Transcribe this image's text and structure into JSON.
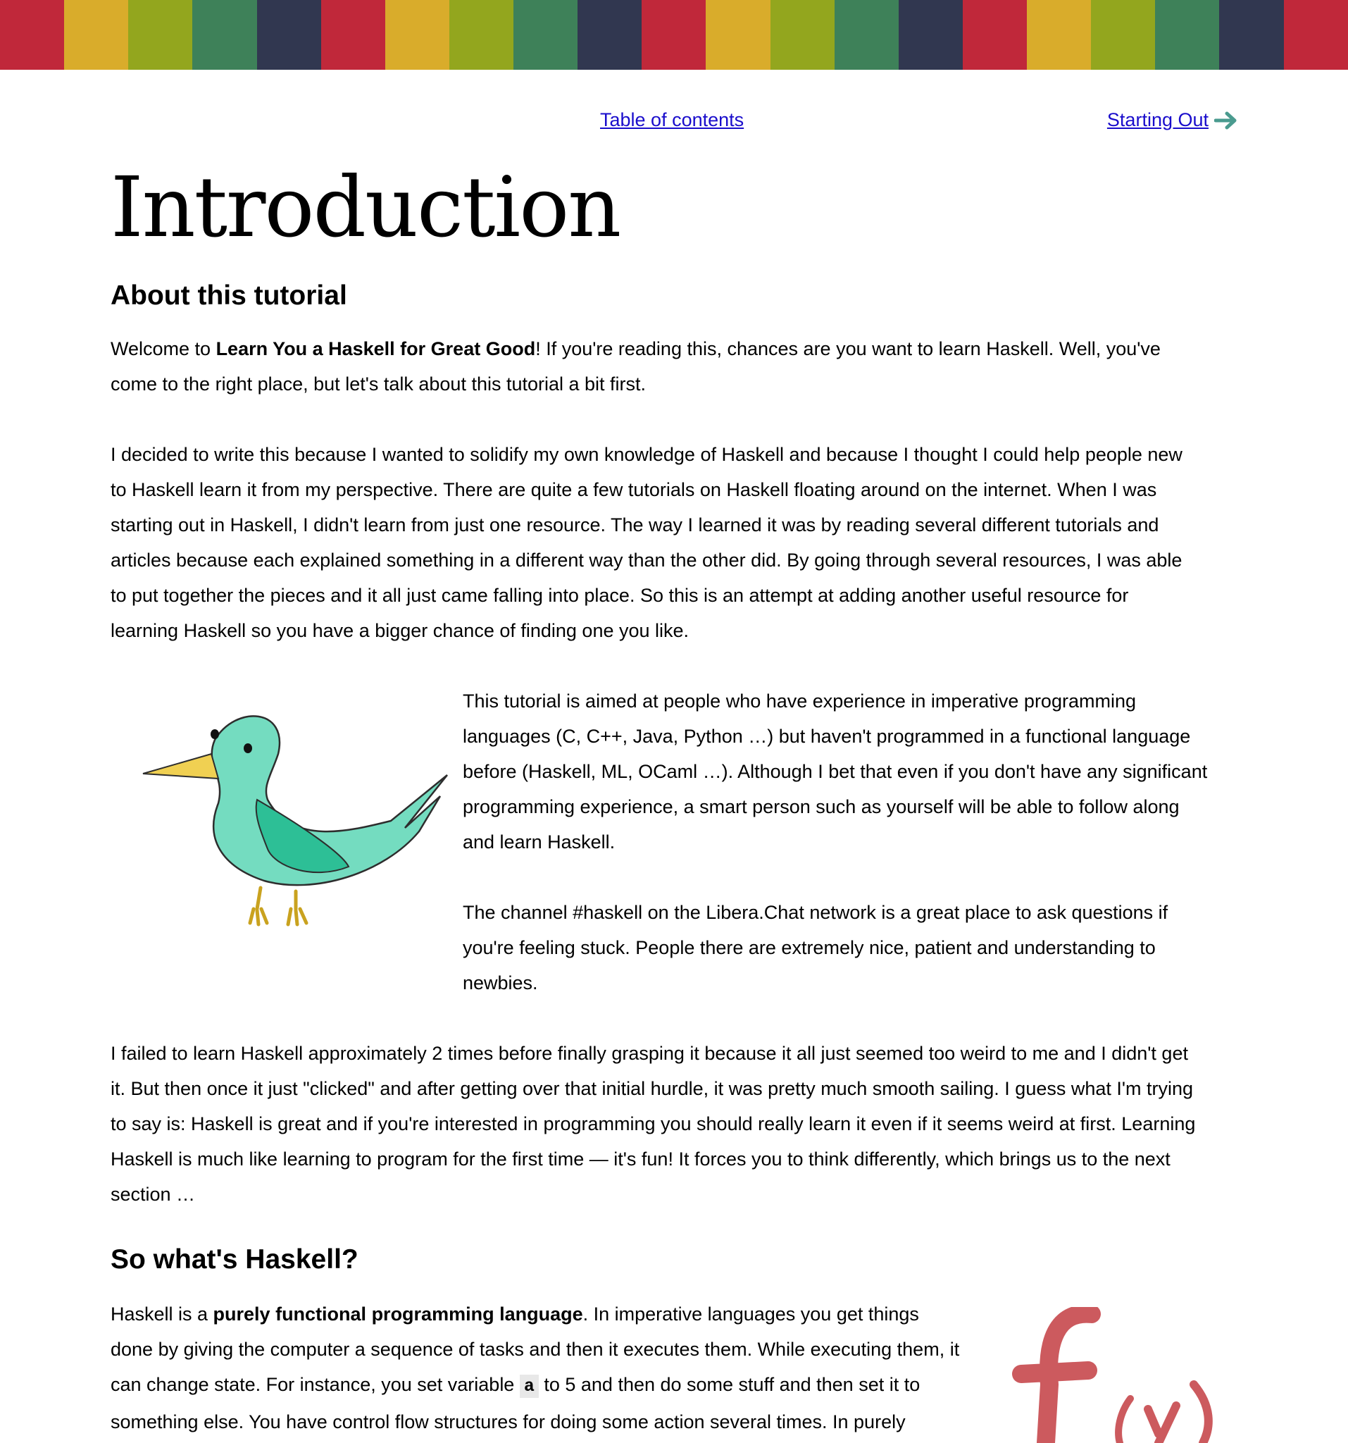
{
  "stripe_colors": [
    "#c0283a",
    "#d9ac2b",
    "#93a61e",
    "#3e8159",
    "#313750",
    "#c0283a",
    "#d9ac2b",
    "#93a61e",
    "#3e8159",
    "#313750",
    "#c0283a",
    "#d9ac2b",
    "#93a61e",
    "#3e8159",
    "#313750",
    "#c0283a",
    "#d9ac2b",
    "#93a61e",
    "#3e8159",
    "#313750",
    "#c0283a"
  ],
  "nav": {
    "toc_label": "Table of contents",
    "next_label": "Starting Out",
    "arrow_icon": "right-arrow-icon"
  },
  "page": {
    "title": "Introduction"
  },
  "section1": {
    "heading": "About this tutorial",
    "p1_pre": "Welcome to ",
    "p1_bold": "Learn You a Haskell for Great Good",
    "p1_line1_post": "! If you're reading this, chances are you want to learn Haskell. Well, you've",
    "p1_line2": "come to the right place, but let's talk about this tutorial a bit first.",
    "p2_lines": [
      "I decided to write this because I wanted to solidify my own knowledge of Haskell and because I thought I could help people new",
      "to Haskell learn it from my perspective. There are quite a few tutorials on Haskell floating around on the internet. When I was",
      "starting out in Haskell, I didn't learn from just one resource. The way I learned it was by reading several different tutorials and",
      "articles because each explained something in a different way than the other did. By going through several resources, I was able",
      "to put together the pieces and it all just came falling into place. So this is an attempt at adding another useful resource for",
      "learning Haskell so you have a bigger chance of finding one you like."
    ],
    "p3_lines": [
      "This tutorial is aimed at people who have experience in imperative programming",
      "languages (C, C++, Java, Python …) but haven't programmed in a functional language",
      "before (Haskell, ML, OCaml …). Although I bet that even if you don't have any significant",
      "programming experience, a smart person such as yourself will be able to follow along",
      "and learn Haskell."
    ],
    "p4_lines": [
      "The channel #haskell on the Libera.Chat network is a great place to ask questions if",
      "you're feeling stuck. People there are extremely nice, patient and understanding to",
      "newbies."
    ],
    "p5_lines": [
      "I failed to learn Haskell approximately 2 times before finally grasping it because it all just seemed too weird to me and I didn't get",
      "it. But then once it just \"clicked\" and after getting over that initial hurdle, it was pretty much smooth sailing. I guess what I'm trying",
      "to say is: Haskell is great and if you're interested in programming you should really learn it even if it seems weird at first. Learning",
      "Haskell is much like learning to program for the first time — it's fun! It forces you to think differently, which brings us to the next",
      "section …"
    ]
  },
  "section2": {
    "heading": "So what's Haskell?",
    "l1_pre": "Haskell is a ",
    "l1_bold": "purely functional programming language",
    "l1_post": ". In imperative languages you get things",
    "l2": "done by giving the computer a sequence of tasks and then it executes them. While executing them, it",
    "l3_pre": "can change state. For instance, you set variable ",
    "l3_code": "a",
    "l3_post": " to 5 and then do some stuff and then set it to",
    "l4": "something else. You have control flow structures for doing some action several times. In purely"
  }
}
